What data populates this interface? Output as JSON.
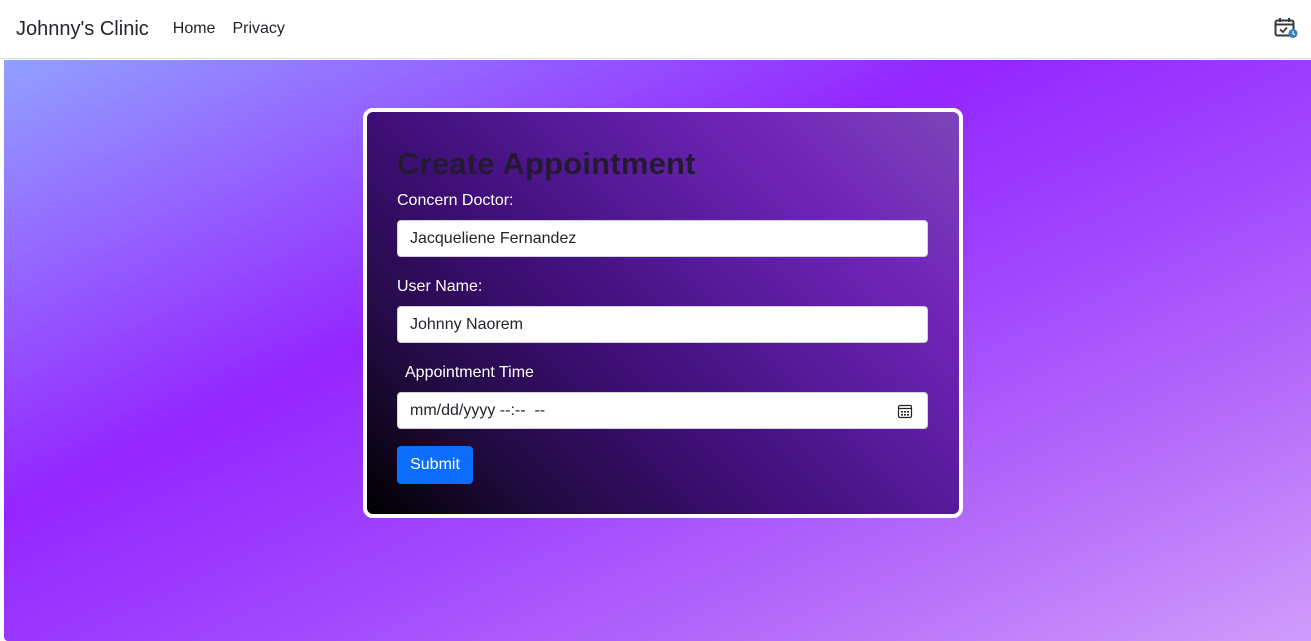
{
  "navbar": {
    "brand": "Johnny's Clinic",
    "links": [
      {
        "label": "Home"
      },
      {
        "label": "Privacy"
      }
    ],
    "icon": "calendar-check-icon",
    "icon_accent": "#2f7fc1"
  },
  "form": {
    "title": "Create Appointment",
    "doctor_label": "Concern Doctor:",
    "doctor_value": "Jacqueliene Fernandez",
    "user_label": "User Name:",
    "user_value": "Johnny Naorem",
    "time_label": "Appointment Time",
    "time_value": "mm/dd/yyyy --:--  --",
    "time_icon": "calendar-icon",
    "submit_label": "Submit"
  },
  "colors": {
    "accent": "#0d6efd",
    "background_gradient": [
      "#91a0ff",
      "#9425ff",
      "#d09cfb"
    ],
    "card_gradient": [
      "#000000",
      "#3d0e75",
      "#7c45b8"
    ]
  }
}
